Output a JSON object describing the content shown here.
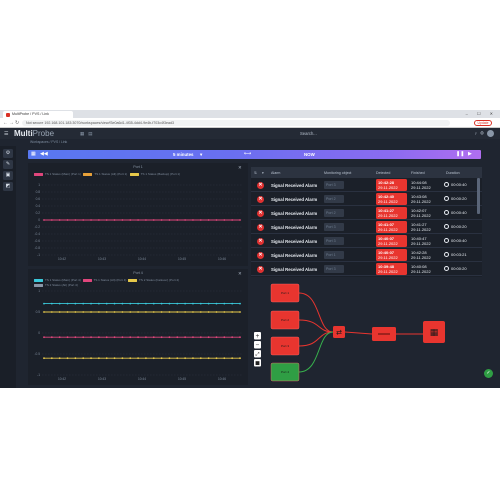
{
  "browser": {
    "tab_title": "MultiProbe / PVS / Link",
    "address": "Not secure   192.168.101.183:3070/workspaces/view/f3e0a6d1-4f35-4dd4-9e4b-f703c4f3ead3",
    "update_label": "Update"
  },
  "app": {
    "logo_bold": "Multi",
    "logo_light": "Probe",
    "search_label": "Search...",
    "breadcrumb": "Workspaces  /  PVS / Link"
  },
  "timebar": {
    "range_label": "5 minutes",
    "now_label": "NOW"
  },
  "chart1": {
    "title": "Port 1",
    "legend": [
      {
        "label": "TS 1 Status (Main) (Port 1)",
        "color": "#e0467c"
      },
      {
        "label": "TS 1 Status (Alt) (Port 1)",
        "color": "#e8a23a"
      },
      {
        "label": "TS 1 Status (Backup) (Port 1)",
        "color": "#e6c84a"
      }
    ],
    "chart_data": {
      "type": "line",
      "title": "Port 1",
      "x": [
        "10:42",
        "10:43",
        "10:44",
        "10:45",
        "10:46"
      ],
      "y_ticks": [
        "1",
        "0.8",
        "0.6",
        "0.4",
        "0.2",
        "0",
        "-0.2",
        "-0.4",
        "-0.6",
        "-0.8",
        "-1"
      ],
      "ylim": [
        -1,
        1
      ],
      "series": [
        {
          "name": "TS 1 Status (Main) (Port 1)",
          "color": "#e0467c",
          "values": [
            0,
            0,
            0,
            0,
            0
          ]
        }
      ]
    }
  },
  "chart2": {
    "title": "Port 4",
    "legend": [
      {
        "label": "TS 1 Status (Main) (Port 4)",
        "color": "#3bc9db"
      },
      {
        "label": "TS 1 Status (Alt) (Port 4)",
        "color": "#e0467c"
      },
      {
        "label": "TS 2 Status (Failover) (Port 4)",
        "color": "#e6c84a"
      },
      {
        "label": "TS 2 Status (Alt) (Port 4)",
        "color": "#8a97a8"
      }
    ],
    "chart_data": {
      "type": "line",
      "title": "Port 4",
      "x": [
        "10:42",
        "10:43",
        "10:44",
        "10:45",
        "10:46"
      ],
      "y_ticks": [
        "1",
        "0.5",
        "0",
        "-0.5",
        "-1"
      ],
      "ylim": [
        -1,
        1
      ],
      "series": [
        {
          "name": "TS 1 Status (Main) (Port 4)",
          "color": "#3bc9db",
          "values": [
            0.7,
            0.7,
            0.7,
            0.7,
            0.7
          ]
        },
        {
          "name": "TS 2 Status (Failover) (Port 4)",
          "color": "#e6c84a",
          "values": [
            0.5,
            0.5,
            0.5,
            0.5,
            0.5
          ]
        },
        {
          "name": "TS 1 Status (Alt) (Port 4)",
          "color": "#e0467c",
          "values": [
            -0.1,
            -0.1,
            -0.1,
            -0.1,
            -0.1
          ]
        },
        {
          "name": "TS 2 Status (Backup) (Port 4)",
          "color": "#e6c84a",
          "values": [
            -0.6,
            -0.6,
            -0.6,
            -0.6,
            -0.6
          ]
        }
      ]
    }
  },
  "alarms": {
    "headers": {
      "alarm": "Alarm",
      "object": "Monitoring object",
      "detected": "Detected",
      "finished": "Finished",
      "duration": "Duration"
    },
    "rows": [
      {
        "name": "Signal Received Alarm",
        "object": "Port 3",
        "det_time": "10:42:28",
        "det_date": "29.11.2022",
        "fin_time": "10:44:08",
        "fin_date": "29.11.2022",
        "duration": "00:00:40"
      },
      {
        "name": "Signal Received Alarm",
        "object": "Port 2",
        "det_time": "10:42:40",
        "det_date": "29.11.2022",
        "fin_time": "10:43:08",
        "fin_date": "29.11.2022",
        "duration": "00:00:20"
      },
      {
        "name": "Signal Received Alarm",
        "object": "Port 2",
        "det_time": "10:41:27",
        "det_date": "29.11.2022",
        "fin_time": "10:42:07",
        "fin_date": "29.11.2022",
        "duration": "00:00:40"
      },
      {
        "name": "Signal Received Alarm",
        "object": "Port 3",
        "det_time": "10:41:07",
        "det_date": "29.11.2022",
        "fin_time": "10:41:27",
        "fin_date": "29.11.2022",
        "duration": "00:00:20"
      },
      {
        "name": "Signal Received Alarm",
        "object": "Port 3",
        "det_time": "10:40:07",
        "det_date": "29.11.2022",
        "fin_time": "10:40:47",
        "fin_date": "29.11.2022",
        "duration": "00:00:40"
      },
      {
        "name": "Signal Received Alarm",
        "object": "Port 1",
        "det_time": "10:40:07",
        "det_date": "29.11.2022",
        "fin_time": "10:42:28",
        "fin_date": "29.11.2022",
        "duration": "00:03:21"
      },
      {
        "name": "Signal Received Alarm",
        "object": "Port 3",
        "det_time": "10:39:48",
        "det_date": "29.11.2022",
        "fin_time": "10:40:08",
        "fin_date": "29.11.2022",
        "duration": "00:00:20"
      }
    ]
  },
  "topology": {
    "nodes": [
      {
        "label": "Port 1",
        "color": "#e8352f"
      },
      {
        "label": "Port 2",
        "color": "#e8352f"
      },
      {
        "label": "Port 3",
        "color": "#e8352f"
      },
      {
        "label": "Port 4",
        "color": "#2f9e44"
      },
      {
        "label": "Switch",
        "color": "#e8352f"
      },
      {
        "label": "Link",
        "color": "#e8352f"
      },
      {
        "label": "PVS",
        "color": "#e8352f"
      }
    ],
    "link_red": "#e8352f",
    "link_green": "#37b24d",
    "zoom_controls": [
      "+",
      "−",
      "⤢",
      "■"
    ]
  }
}
